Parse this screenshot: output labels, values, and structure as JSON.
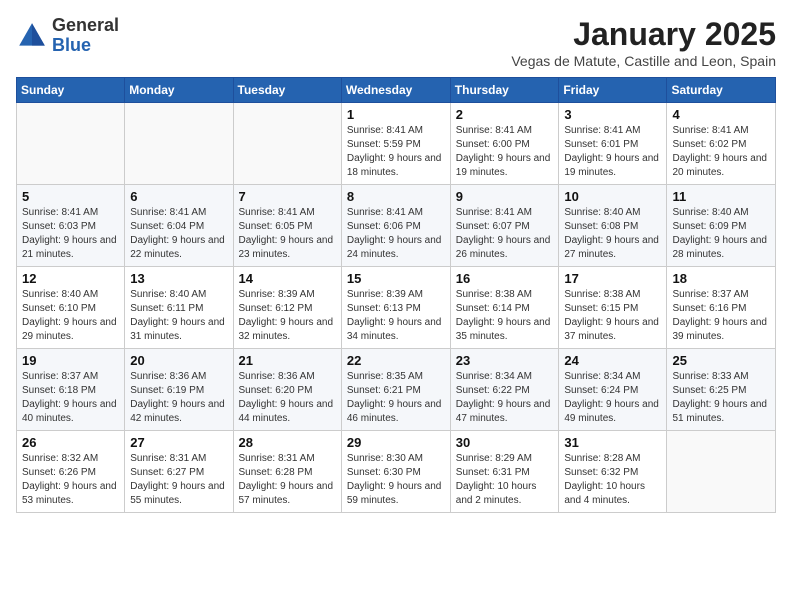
{
  "header": {
    "logo_general": "General",
    "logo_blue": "Blue",
    "month_year": "January 2025",
    "location": "Vegas de Matute, Castille and Leon, Spain"
  },
  "calendar": {
    "days_of_week": [
      "Sunday",
      "Monday",
      "Tuesday",
      "Wednesday",
      "Thursday",
      "Friday",
      "Saturday"
    ],
    "weeks": [
      [
        {
          "day": "",
          "info": ""
        },
        {
          "day": "",
          "info": ""
        },
        {
          "day": "",
          "info": ""
        },
        {
          "day": "1",
          "info": "Sunrise: 8:41 AM\nSunset: 5:59 PM\nDaylight: 9 hours and 18 minutes."
        },
        {
          "day": "2",
          "info": "Sunrise: 8:41 AM\nSunset: 6:00 PM\nDaylight: 9 hours and 19 minutes."
        },
        {
          "day": "3",
          "info": "Sunrise: 8:41 AM\nSunset: 6:01 PM\nDaylight: 9 hours and 19 minutes."
        },
        {
          "day": "4",
          "info": "Sunrise: 8:41 AM\nSunset: 6:02 PM\nDaylight: 9 hours and 20 minutes."
        }
      ],
      [
        {
          "day": "5",
          "info": "Sunrise: 8:41 AM\nSunset: 6:03 PM\nDaylight: 9 hours and 21 minutes."
        },
        {
          "day": "6",
          "info": "Sunrise: 8:41 AM\nSunset: 6:04 PM\nDaylight: 9 hours and 22 minutes."
        },
        {
          "day": "7",
          "info": "Sunrise: 8:41 AM\nSunset: 6:05 PM\nDaylight: 9 hours and 23 minutes."
        },
        {
          "day": "8",
          "info": "Sunrise: 8:41 AM\nSunset: 6:06 PM\nDaylight: 9 hours and 24 minutes."
        },
        {
          "day": "9",
          "info": "Sunrise: 8:41 AM\nSunset: 6:07 PM\nDaylight: 9 hours and 26 minutes."
        },
        {
          "day": "10",
          "info": "Sunrise: 8:40 AM\nSunset: 6:08 PM\nDaylight: 9 hours and 27 minutes."
        },
        {
          "day": "11",
          "info": "Sunrise: 8:40 AM\nSunset: 6:09 PM\nDaylight: 9 hours and 28 minutes."
        }
      ],
      [
        {
          "day": "12",
          "info": "Sunrise: 8:40 AM\nSunset: 6:10 PM\nDaylight: 9 hours and 29 minutes."
        },
        {
          "day": "13",
          "info": "Sunrise: 8:40 AM\nSunset: 6:11 PM\nDaylight: 9 hours and 31 minutes."
        },
        {
          "day": "14",
          "info": "Sunrise: 8:39 AM\nSunset: 6:12 PM\nDaylight: 9 hours and 32 minutes."
        },
        {
          "day": "15",
          "info": "Sunrise: 8:39 AM\nSunset: 6:13 PM\nDaylight: 9 hours and 34 minutes."
        },
        {
          "day": "16",
          "info": "Sunrise: 8:38 AM\nSunset: 6:14 PM\nDaylight: 9 hours and 35 minutes."
        },
        {
          "day": "17",
          "info": "Sunrise: 8:38 AM\nSunset: 6:15 PM\nDaylight: 9 hours and 37 minutes."
        },
        {
          "day": "18",
          "info": "Sunrise: 8:37 AM\nSunset: 6:16 PM\nDaylight: 9 hours and 39 minutes."
        }
      ],
      [
        {
          "day": "19",
          "info": "Sunrise: 8:37 AM\nSunset: 6:18 PM\nDaylight: 9 hours and 40 minutes."
        },
        {
          "day": "20",
          "info": "Sunrise: 8:36 AM\nSunset: 6:19 PM\nDaylight: 9 hours and 42 minutes."
        },
        {
          "day": "21",
          "info": "Sunrise: 8:36 AM\nSunset: 6:20 PM\nDaylight: 9 hours and 44 minutes."
        },
        {
          "day": "22",
          "info": "Sunrise: 8:35 AM\nSunset: 6:21 PM\nDaylight: 9 hours and 46 minutes."
        },
        {
          "day": "23",
          "info": "Sunrise: 8:34 AM\nSunset: 6:22 PM\nDaylight: 9 hours and 47 minutes."
        },
        {
          "day": "24",
          "info": "Sunrise: 8:34 AM\nSunset: 6:24 PM\nDaylight: 9 hours and 49 minutes."
        },
        {
          "day": "25",
          "info": "Sunrise: 8:33 AM\nSunset: 6:25 PM\nDaylight: 9 hours and 51 minutes."
        }
      ],
      [
        {
          "day": "26",
          "info": "Sunrise: 8:32 AM\nSunset: 6:26 PM\nDaylight: 9 hours and 53 minutes."
        },
        {
          "day": "27",
          "info": "Sunrise: 8:31 AM\nSunset: 6:27 PM\nDaylight: 9 hours and 55 minutes."
        },
        {
          "day": "28",
          "info": "Sunrise: 8:31 AM\nSunset: 6:28 PM\nDaylight: 9 hours and 57 minutes."
        },
        {
          "day": "29",
          "info": "Sunrise: 8:30 AM\nSunset: 6:30 PM\nDaylight: 9 hours and 59 minutes."
        },
        {
          "day": "30",
          "info": "Sunrise: 8:29 AM\nSunset: 6:31 PM\nDaylight: 10 hours and 2 minutes."
        },
        {
          "day": "31",
          "info": "Sunrise: 8:28 AM\nSunset: 6:32 PM\nDaylight: 10 hours and 4 minutes."
        },
        {
          "day": "",
          "info": ""
        }
      ]
    ]
  }
}
